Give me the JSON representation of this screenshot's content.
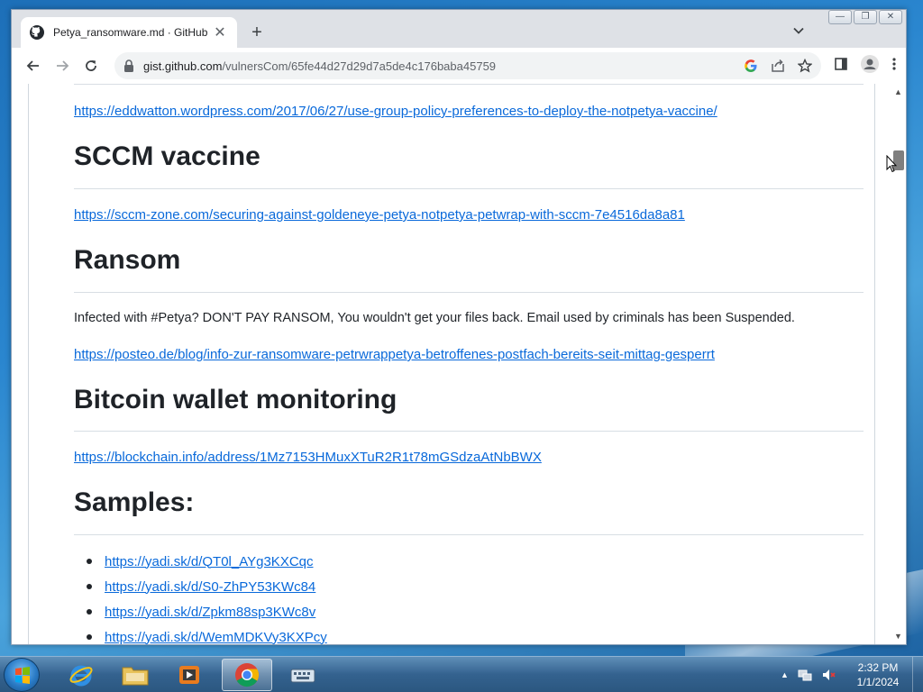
{
  "browser": {
    "tab_title": "Petya_ransomware.md · GitHub",
    "tab_close": "✕",
    "new_tab": "+",
    "url_host": "gist.github.com",
    "url_path": "/vulnersCom/65fe44d27d29d7a5de4c176baba45759",
    "window_controls": {
      "minimize": "—",
      "restore": "❐",
      "close": "✕"
    }
  },
  "content": {
    "link_gpo": "https://eddwatton.wordpress.com/2017/06/27/use-group-policy-preferences-to-deploy-the-notpetya-vaccine/",
    "heading_sccm": "SCCM vaccine",
    "link_sccm": "https://sccm-zone.com/securing-against-goldeneye-petya-notpetya-petwrap-with-sccm-7e4516da8a81",
    "heading_ransom": "Ransom",
    "ransom_text": "Infected with #Petya? DON'T PAY RANSOM, You wouldn't get your files back. Email used by criminals has been Suspended.",
    "link_posteo": "https://posteo.de/blog/info-zur-ransomware-petrwrappetya-betroffenes-postfach-bereits-seit-mittag-gesperrt",
    "heading_bitcoin": "Bitcoin wallet monitoring",
    "link_blockchain": "https://blockchain.info/address/1Mz7153HMuxXTuR2R1t78mGSdzaAtNbBWX",
    "heading_samples": "Samples:",
    "samples": [
      "https://yadi.sk/d/QT0l_AYg3KXCqc",
      "https://yadi.sk/d/S0-ZhPY53KWc84",
      "https://yadi.sk/d/Zpkm88sp3KWc8v",
      "https://yadi.sk/d/WemMDKVy3KXPcy"
    ]
  },
  "taskbar": {
    "time": "2:32 PM",
    "date": "1/1/2024",
    "tray_arrow": "▲"
  },
  "scrollbar": {
    "up": "▲",
    "down": "▼"
  },
  "colors": {
    "link": "#0969da",
    "taskbar": "#34628f",
    "chrome_bg": "#dee1e6"
  }
}
